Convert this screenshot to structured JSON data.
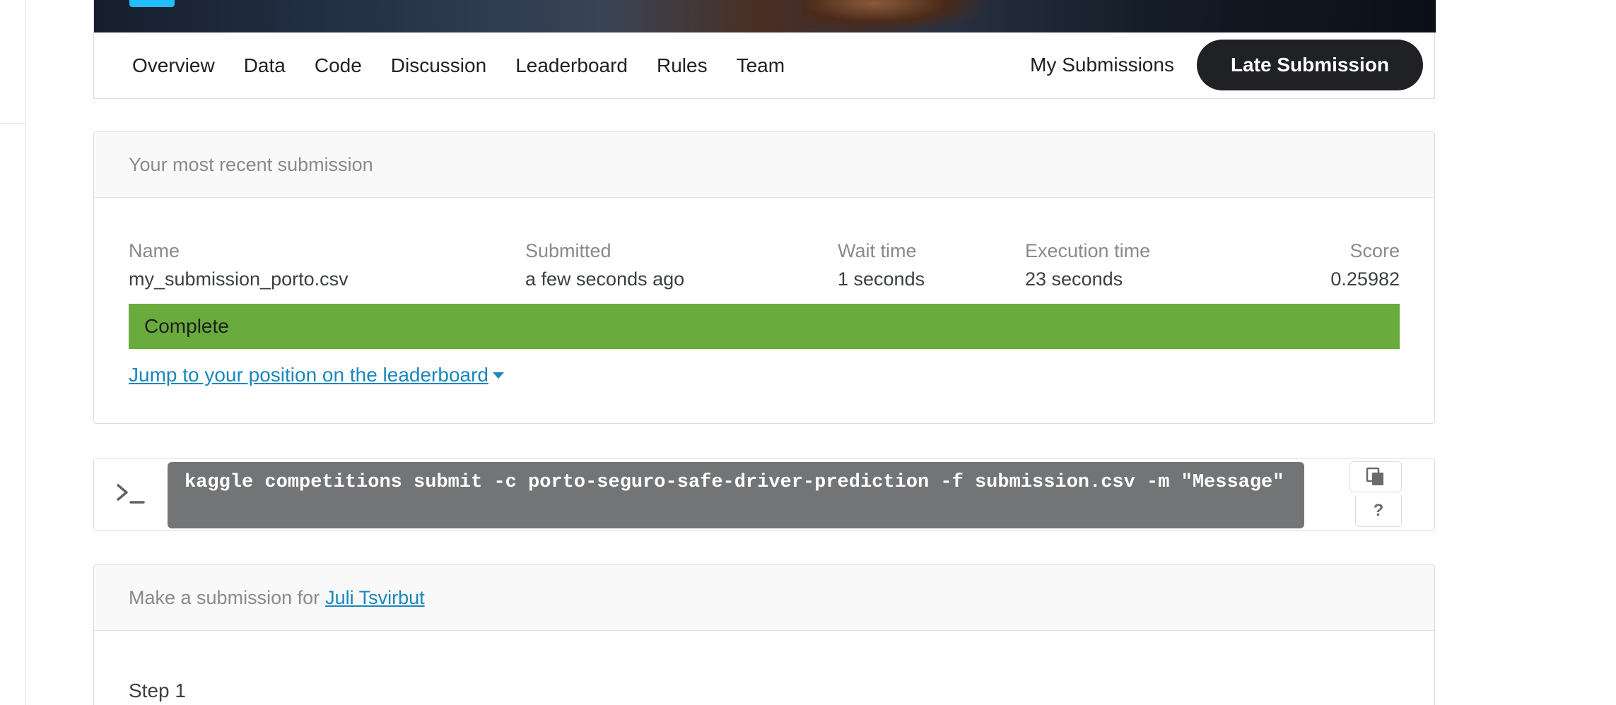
{
  "nav": {
    "tabs": [
      "Overview",
      "Data",
      "Code",
      "Discussion",
      "Leaderboard",
      "Rules",
      "Team"
    ],
    "my_submissions": "My Submissions",
    "late_submission": "Late Submission"
  },
  "recent": {
    "header": "Your most recent submission",
    "columns": {
      "name_label": "Name",
      "name_value": "my_submission_porto.csv",
      "submitted_label": "Submitted",
      "submitted_value": "a few seconds ago",
      "wait_label": "Wait time",
      "wait_value": "1 seconds",
      "exec_label": "Execution time",
      "exec_value": "23 seconds",
      "score_label": "Score",
      "score_value": "0.25982"
    },
    "status": "Complete",
    "status_color": "#6aab3d",
    "jump_link": "Jump to your position on the leaderboard"
  },
  "cli": {
    "command": "kaggle competitions submit -c porto-seguro-safe-driver-prediction -f submission.csv -m \"Message\"",
    "help": "?",
    "icons": [
      "terminal-prompt-icon",
      "copy-icon"
    ]
  },
  "make_submission": {
    "prefix": "Make a submission for",
    "team_name": "Juli Tsvirbut",
    "step": "Step 1"
  },
  "colors": {
    "accent_link": "#1a86bd",
    "primary_button": "#202124",
    "banner_badge": "#20beff"
  }
}
